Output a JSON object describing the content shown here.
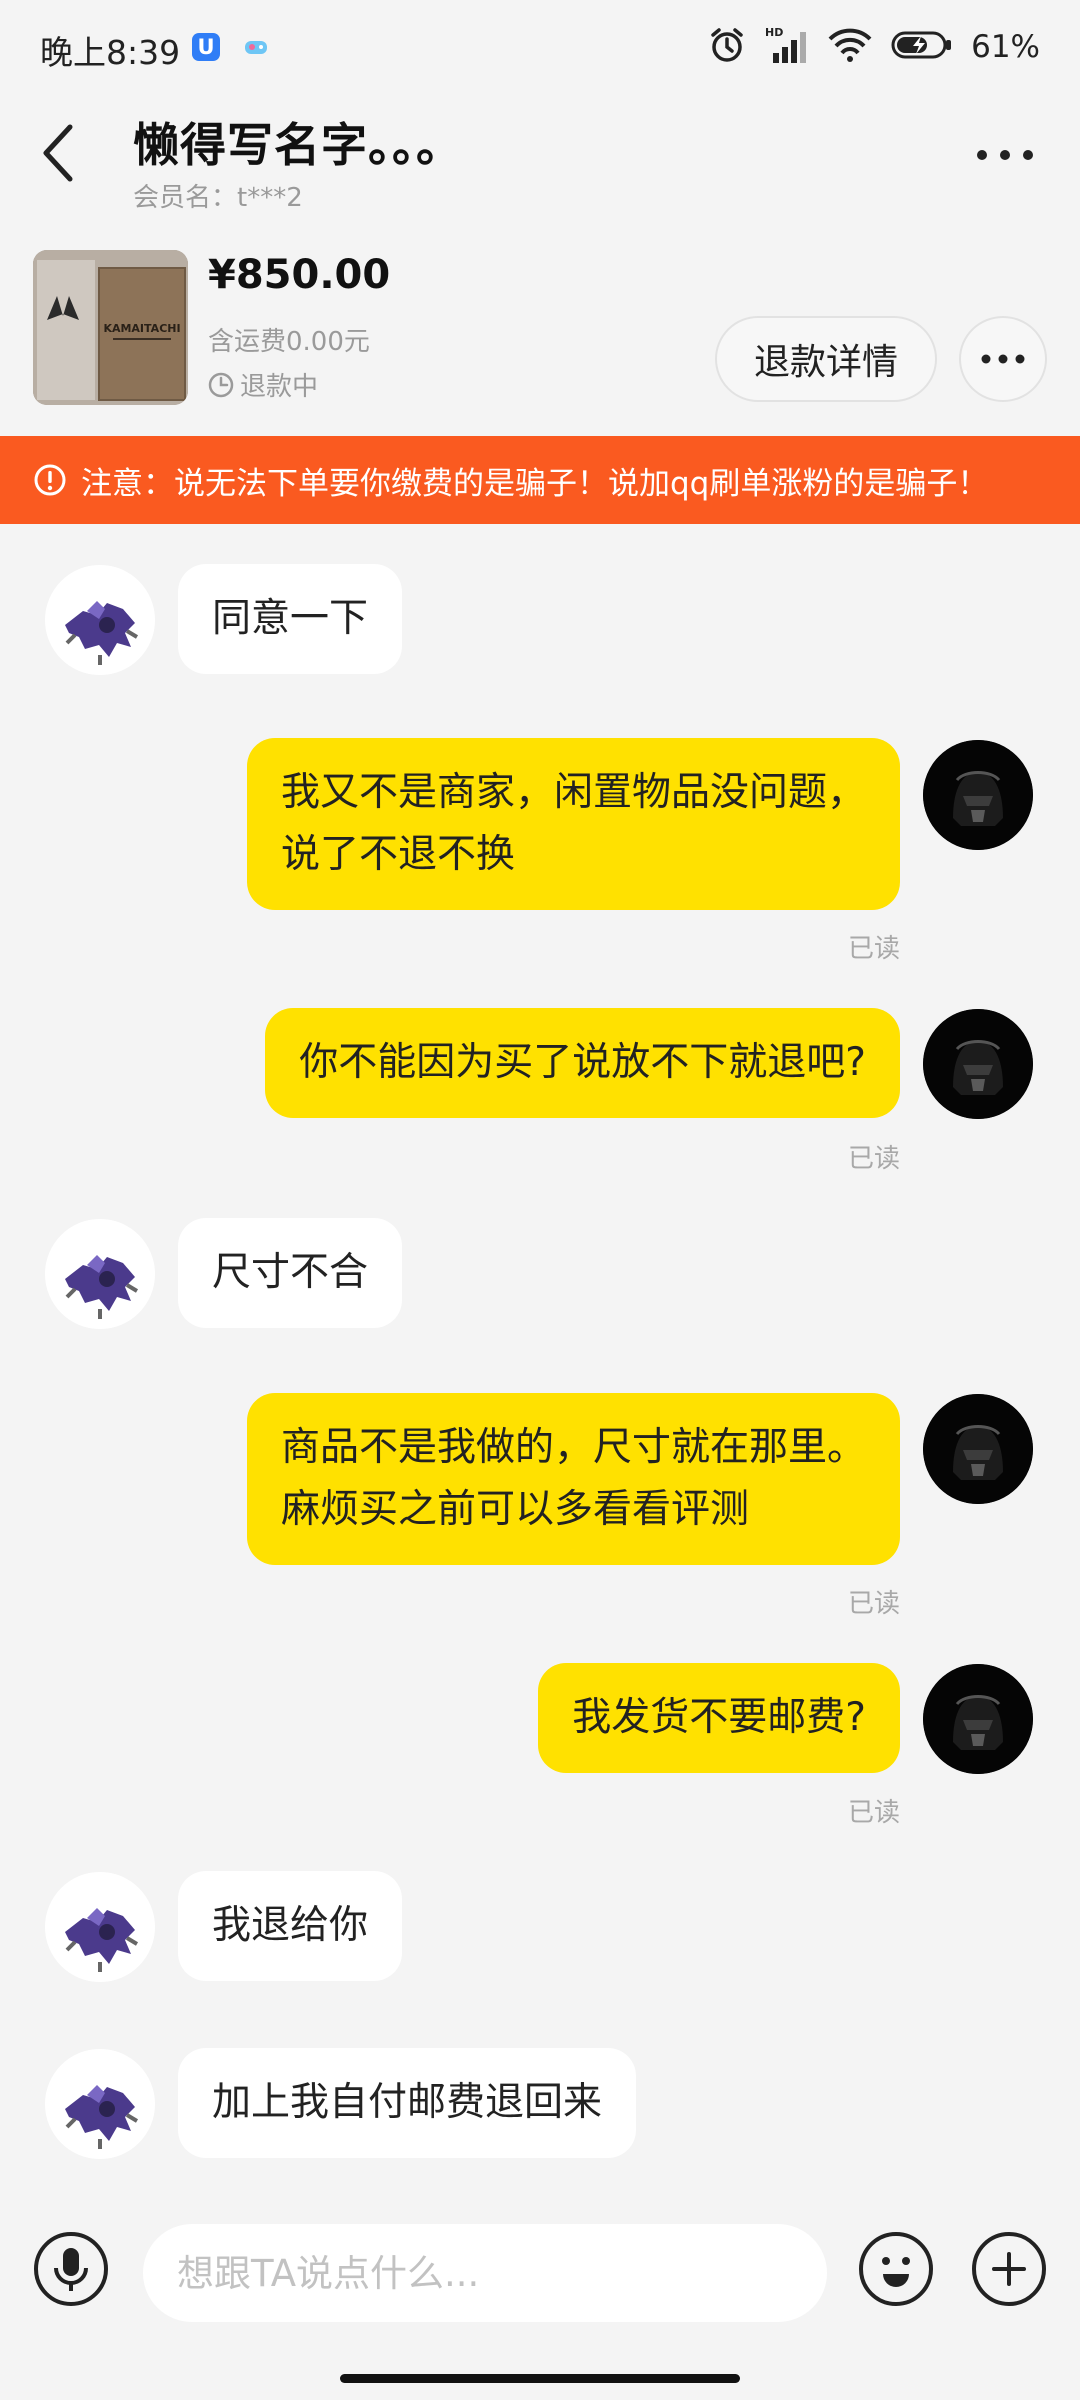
{
  "status_bar": {
    "time": "晚上8:39",
    "battery": "61%",
    "icons": [
      "app-u-icon",
      "game-icon",
      "alarm-icon",
      "signal-icon",
      "wifi-icon",
      "battery-icon"
    ]
  },
  "header": {
    "title": "懒得写名字。。。",
    "member": "会员名：t***2"
  },
  "product": {
    "thumbnail_text": "KAMAITACHI",
    "price": "¥850.00",
    "shipping": "含运费0.00元",
    "status": "退款中",
    "refund_button": "退款详情"
  },
  "warning": {
    "text": "注意：说无法下单要你缴费的是骗子！说加qq刷单涨粉的是骗子！"
  },
  "messages": [
    {
      "from": "them",
      "lines": [
        "同意一下"
      ]
    },
    {
      "from": "me",
      "lines": [
        "我又不是商家，闲置物品没问题，",
        "说了不退不换"
      ],
      "status": "已读"
    },
    {
      "from": "me",
      "lines": [
        "你不能因为买了说放不下就退吧?"
      ],
      "status": "已读"
    },
    {
      "from": "them",
      "lines": [
        "尺寸不合"
      ]
    },
    {
      "from": "me",
      "lines": [
        "商品不是我做的，尺寸就在那里。",
        "麻烦买之前可以多看看评测"
      ],
      "status": "已读"
    },
    {
      "from": "me",
      "lines": [
        "我发货不要邮费?"
      ],
      "status": "已读"
    },
    {
      "from": "them",
      "lines": [
        "我退给你"
      ]
    },
    {
      "from": "them",
      "lines": [
        "加上我自付邮费退回来"
      ]
    }
  ],
  "input": {
    "placeholder": "想跟TA说点什么..."
  },
  "colors": {
    "warning_bg": "#fa5a20",
    "my_bubble": "#ffe100",
    "their_bubble": "#ffffff",
    "background": "#f4f4f4"
  }
}
